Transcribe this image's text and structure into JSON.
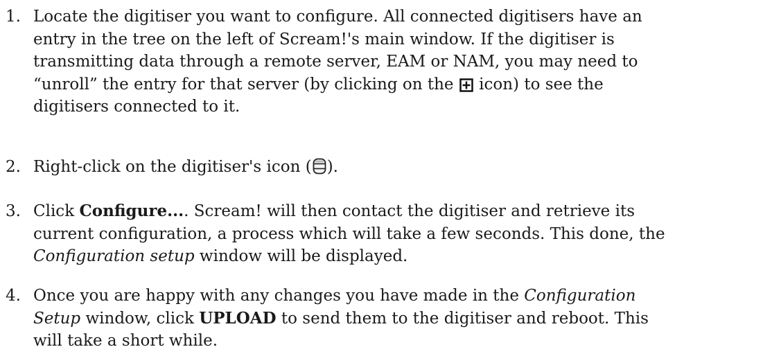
{
  "steps": [
    {
      "number": "1.",
      "lines": [
        "Locate the digitiser you want to configure.  All connected digitisers have an",
        "entry in the tree on the left of Scream!'s main window.  If the digitiser is",
        "transmitting data through a remote server, EAM or NAM, you may need to",
        "“unroll” the entry for that server (by clicking on the",
        "icon) to see the",
        "digitisers connected to it."
      ],
      "icon": "plus-box-icon"
    },
    {
      "number": "2.",
      "text_before_icon": "Right-click on the digitiser's icon (",
      "text_after_icon": ").",
      "icon": "digitiser-icon"
    },
    {
      "number": "3.",
      "line1_before": "Click ",
      "line1_bold": "Configure...",
      "line1_after": ".  Scream! will then contact the digitiser and retrieve its",
      "line2": "current configuration, a process which will take a few seconds.  This done, the",
      "line3_italic": "Configuration setup",
      "line3_after": " window will be displayed."
    },
    {
      "number": "4.",
      "line1_before": "Once you are happy with any changes you have made in the ",
      "line1_italic": "Configuration",
      "line2_italic": "Setup",
      "line2_middle": " window, click ",
      "line2_bold": "UPLOAD",
      "line2_after": " to send them to the digitiser and reboot.  This",
      "line3": "will take a short while."
    }
  ]
}
